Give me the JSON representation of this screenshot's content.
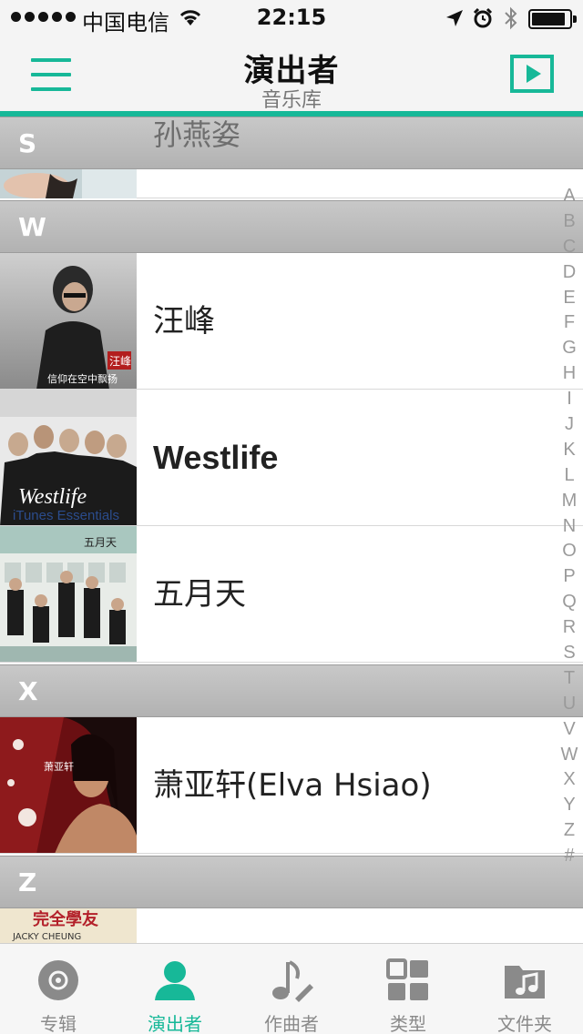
{
  "status_bar": {
    "carrier": "中国电信",
    "time": "22:15"
  },
  "nav": {
    "title": "演出者",
    "subtitle": "音乐库",
    "menu_icon": "hamburger-menu-icon",
    "play_icon": "now-playing-icon"
  },
  "colors": {
    "accent": "#17b898",
    "section_header": "#bcbcbc"
  },
  "sections": [
    {
      "letter": "S",
      "artists": [
        "孙燕姿"
      ]
    },
    {
      "letter": "W",
      "artists": [
        "汪峰",
        "Westlife",
        "五月天"
      ]
    },
    {
      "letter": "X",
      "artists": [
        "萧亚轩(Elva Hsiao)"
      ]
    },
    {
      "letter": "Z",
      "artists": []
    }
  ],
  "album_art_text": {
    "wangfeng": "汪峰",
    "wangfeng_sub": "信仰在空中飘扬",
    "westlife_title": "Westlife",
    "westlife_sub": "iTunes Essentials",
    "mayday": "五月天",
    "elva": "萧亚轩",
    "jacky_title": "完全學友",
    "jacky_sub": "JACKY CHEUNG"
  },
  "index_letters": [
    "A",
    "B",
    "C",
    "D",
    "E",
    "F",
    "G",
    "H",
    "I",
    "J",
    "K",
    "L",
    "M",
    "N",
    "O",
    "P",
    "Q",
    "R",
    "S",
    "T",
    "U",
    "V",
    "W",
    "X",
    "Y",
    "Z",
    "#"
  ],
  "tabs": [
    {
      "label": "专辑",
      "icon": "album-disc-icon",
      "active": false
    },
    {
      "label": "演出者",
      "icon": "artist-person-icon",
      "active": true
    },
    {
      "label": "作曲者",
      "icon": "composer-note-icon",
      "active": false
    },
    {
      "label": "类型",
      "icon": "genre-grid-icon",
      "active": false
    },
    {
      "label": "文件夹",
      "icon": "folder-music-icon",
      "active": false
    }
  ]
}
